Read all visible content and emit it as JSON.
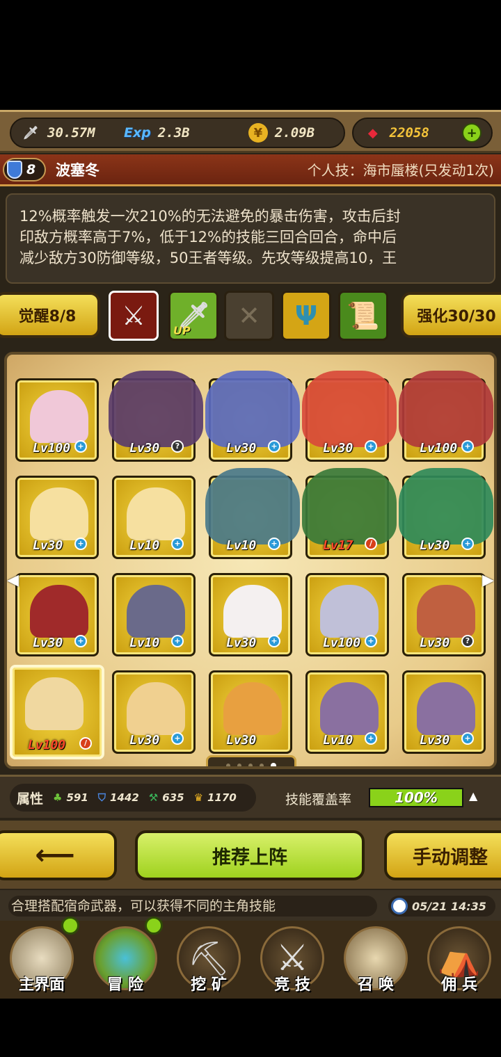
{
  "resources": {
    "attack": "30.57M",
    "exp_icon": "Exp",
    "exp": "2.3B",
    "gold": "2.09B",
    "gems": "22058"
  },
  "hero": {
    "level": "8",
    "name": "波塞冬",
    "personal_skill": "个人技：海市蜃楼(只发动1次)"
  },
  "description": [
    "12%概率触发一次210%的无法避免的暴击伤害，攻击后封",
    "印敌方概率高于7%，低于12%的技能三回合回合，命中后",
    "减少敌方30防御等级，50王者等级。先攻等级提高10，王"
  ],
  "weapon_row": {
    "awaken_label": "觉醒8/8",
    "enhance_label": "强化30/30",
    "up_label": "UP",
    "empty_slot": "✕"
  },
  "grid": [
    [
      {
        "lv": "Lv100",
        "badge": "plus"
      },
      {
        "lv": "Lv30",
        "badge": "q"
      },
      {
        "lv": "Lv30",
        "badge": "plus"
      },
      {
        "lv": "Lv30",
        "badge": "plus"
      },
      {
        "lv": "Lv100",
        "badge": "plus"
      }
    ],
    [
      {
        "lv": "Lv30",
        "badge": "plus"
      },
      {
        "lv": "Lv10",
        "badge": "plus"
      },
      {
        "lv": "Lv10",
        "badge": "plus"
      },
      {
        "lv": "Lv17",
        "badge": "red"
      },
      {
        "lv": "Lv30",
        "badge": "plus"
      }
    ],
    [
      {
        "lv": "Lv30",
        "badge": "plus"
      },
      {
        "lv": "Lv10",
        "badge": "plus"
      },
      {
        "lv": "Lv30",
        "badge": "plus"
      },
      {
        "lv": "Lv100",
        "badge": "plus"
      },
      {
        "lv": "Lv30",
        "badge": "q"
      }
    ],
    [
      {
        "lv": "Lv100",
        "badge": "red"
      },
      {
        "lv": "Lv30",
        "badge": "plus"
      },
      {
        "lv": "Lv30",
        "badge": ""
      },
      {
        "lv": "Lv10",
        "badge": "plus"
      },
      {
        "lv": "Lv30",
        "badge": "plus"
      }
    ]
  ],
  "stats": {
    "label": "属性",
    "s1": "591",
    "s2": "1442",
    "s3": "635",
    "s4": "1170",
    "coverage_label": "技能覆盖率",
    "coverage": "100%",
    "coverage_fraction": 1.0
  },
  "actions": {
    "back": "⟵",
    "recommend": "推荐上阵",
    "manual": "手动调整"
  },
  "tip": {
    "text": "合理搭配宿命武器，可以获得不同的主角技能",
    "time": "05/21 14:35"
  },
  "nav": [
    "主界面",
    "冒 险",
    "挖 矿",
    "竞 技",
    "召 唤",
    "佣 兵"
  ],
  "colors": {
    "accent_green": "#8ad21a",
    "gold": "#d2a414",
    "title_red": "#8b3418"
  }
}
